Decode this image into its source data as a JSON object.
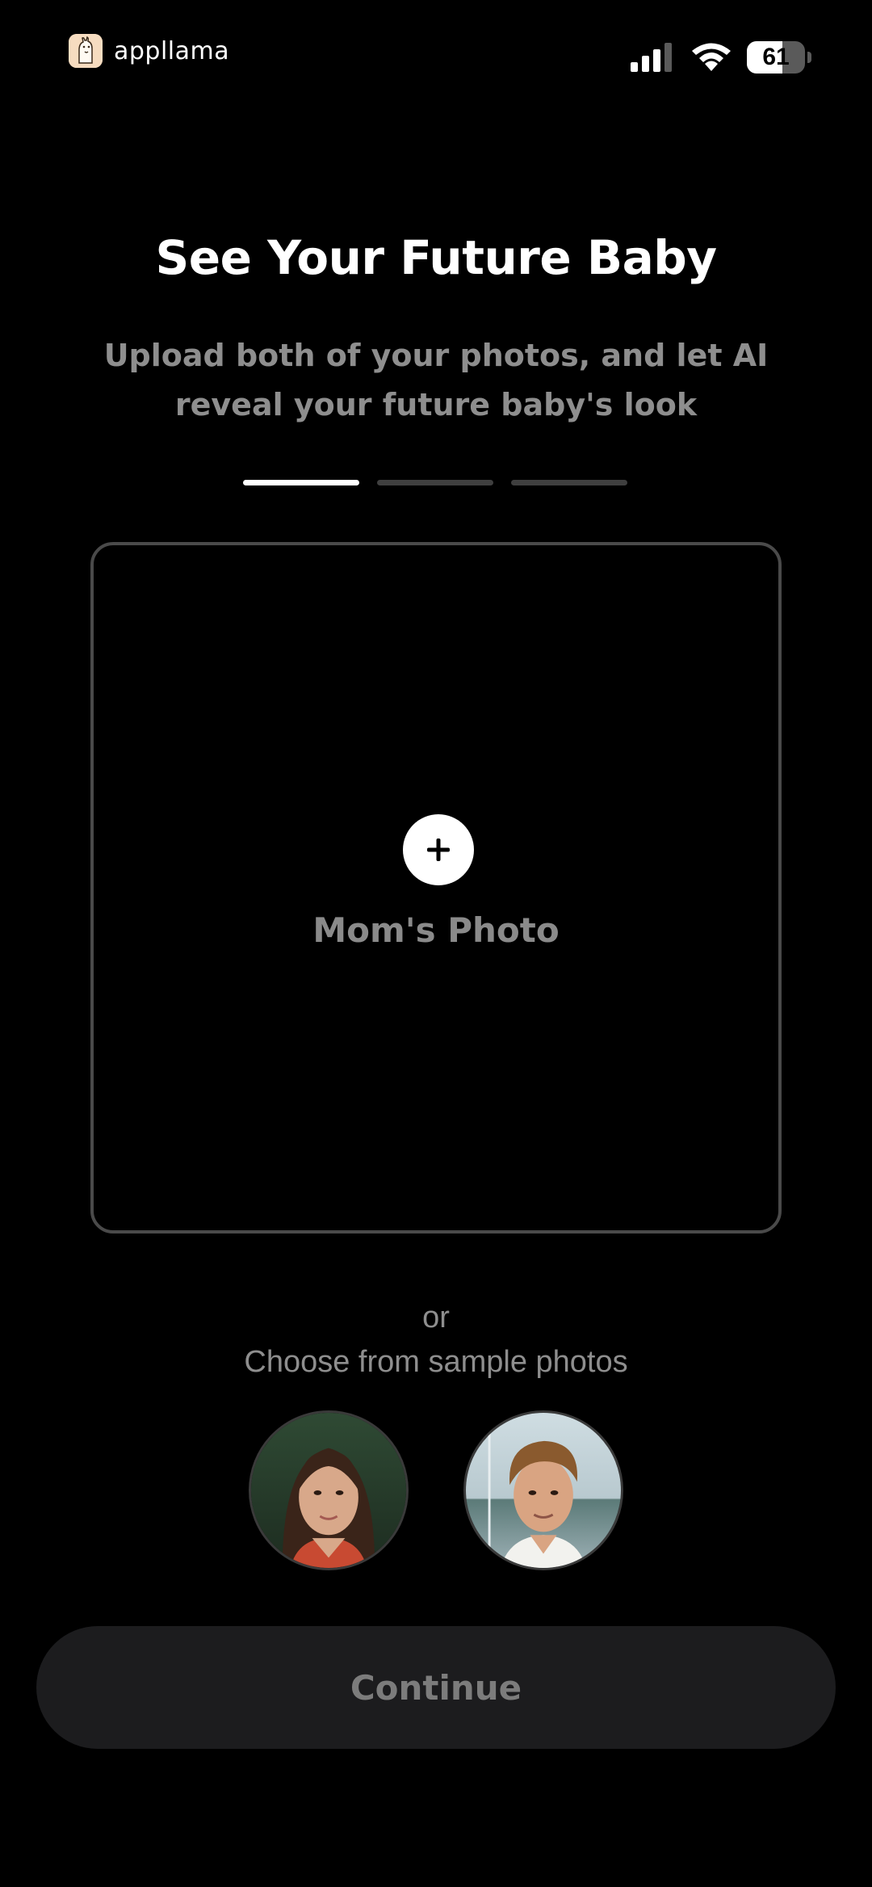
{
  "status_bar": {
    "brand_name": "appllama",
    "brand_icon": "llama-logo-icon",
    "battery_level": "61",
    "battery_fraction": 0.61,
    "icons": [
      "cellular-signal-icon",
      "wifi-icon",
      "battery-icon"
    ]
  },
  "header": {
    "title": "See Your Future Baby",
    "subtitle": "Upload both of your photos, and let AI reveal your future baby's look"
  },
  "progress": {
    "total_steps": 3,
    "current_step": 1
  },
  "upload": {
    "label": "Mom's Photo",
    "icon": "plus-icon"
  },
  "samples": {
    "or_text": "or",
    "prompt": "Choose from sample photos",
    "items": [
      {
        "kind": "woman"
      },
      {
        "kind": "man"
      }
    ]
  },
  "footer": {
    "continue_label": "Continue"
  },
  "colors": {
    "background": "#000000",
    "muted_text": "#8e8e8e",
    "button_bg": "#1c1c1e",
    "progress_active": "#ffffff",
    "progress_inactive": "#3f3f3f"
  }
}
